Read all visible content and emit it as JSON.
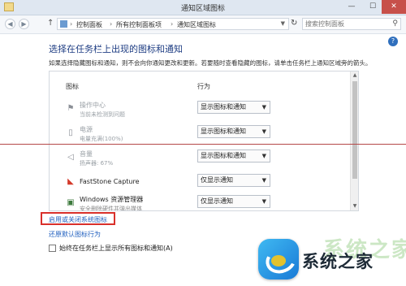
{
  "window": {
    "title": "通知区域图标",
    "min": "—",
    "max": "☐",
    "close": "✕"
  },
  "address": {
    "crumbs": [
      "控制面板",
      "所有控制面板项",
      "通知区域图标"
    ],
    "separator": "›",
    "search_placeholder": "搜索控制面板"
  },
  "main": {
    "heading": "选择在任务栏上出现的图标和通知",
    "description": "如果选择隐藏图标和通知，则不会向你通知更改和更新。若要随时查看隐藏的图标，请单击任务栏上通知区域旁的箭头。",
    "col_icon": "图标",
    "col_behavior": "行为",
    "rows": [
      {
        "name": "操作中心",
        "sub": "当前未检测到问题",
        "behavior": "显示图标和通知",
        "icon": "flag-icon"
      },
      {
        "name": "电源",
        "sub": "电量充满(100%)",
        "behavior": "显示图标和通知",
        "icon": "battery-icon"
      },
      {
        "name": "音量",
        "sub": "扬声器: 67%",
        "behavior": "显示图标和通知",
        "icon": "speaker-icon"
      },
      {
        "name": "FastStone Capture",
        "sub": "",
        "behavior": "仅显示通知",
        "icon": "faststone-icon"
      },
      {
        "name": "Windows 资源管理器",
        "sub": "安全删除硬件并弹出媒体",
        "behavior": "仅显示通知",
        "icon": "usb-icon"
      }
    ]
  },
  "links": {
    "system_icons": "启用或关闭系统图标",
    "restore_defaults": "还原默认图标行为"
  },
  "checkbox": {
    "label": "始终在任务栏上显示所有图标和通知(A)",
    "checked": false
  },
  "watermark": {
    "text": "系统之家",
    "ghost": "系统之家"
  },
  "colors": {
    "heading": "#1e3d83",
    "link": "#1f5fbf",
    "highlight_border": "#d9302b",
    "close_button": "#c7504a"
  }
}
